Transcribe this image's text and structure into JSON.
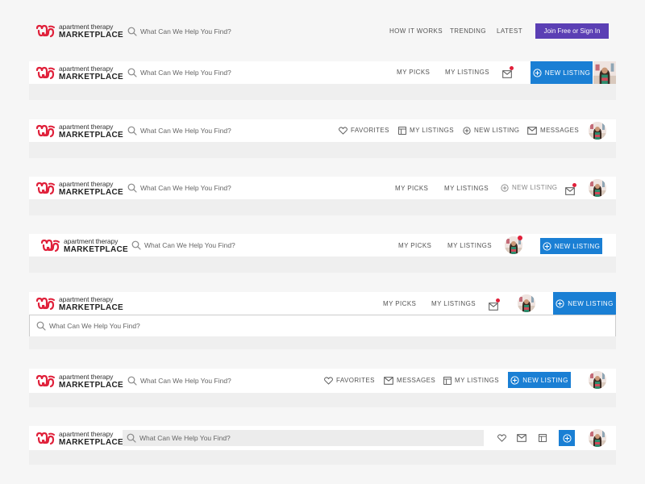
{
  "brand": {
    "line1": "apartment therapy",
    "line2": "MARKETPLACE"
  },
  "search": {
    "placeholder": "What Can We Help You Find?"
  },
  "colors": {
    "brand_red": "#e0203a",
    "primary_blue": "#1a7fd4",
    "purple": "#5b3fb4"
  },
  "icons": [
    "logo-icon",
    "search-icon",
    "mail-icon",
    "heart-icon",
    "listings-icon",
    "plus-circle-icon",
    "avatar"
  ],
  "v1": {
    "nav": [
      "HOW IT WORKS",
      "TRENDING",
      "LATEST"
    ],
    "cta": "Join Free or Sign In"
  },
  "v2": {
    "nav": [
      "MY PICKS",
      "MY LISTINGS"
    ],
    "cta": "NEW LISTING"
  },
  "v3": {
    "nav": [
      "FAVORITES",
      "MY LISTINGS",
      "NEW LISTING",
      "MESSAGES"
    ]
  },
  "v4": {
    "nav": [
      "MY PICKS",
      "MY LISTINGS",
      "NEW LISTING"
    ]
  },
  "v5": {
    "nav": [
      "MY PICKS",
      "MY LISTINGS"
    ],
    "cta": "NEW LISTING"
  },
  "v6": {
    "nav": [
      "MY PICKS",
      "MY LISTINGS"
    ],
    "cta": "NEW LISTING"
  },
  "v7": {
    "nav": [
      "FAVORITES",
      "MESSAGES",
      "MY LISTINGS"
    ],
    "cta": "NEW LISTING"
  }
}
